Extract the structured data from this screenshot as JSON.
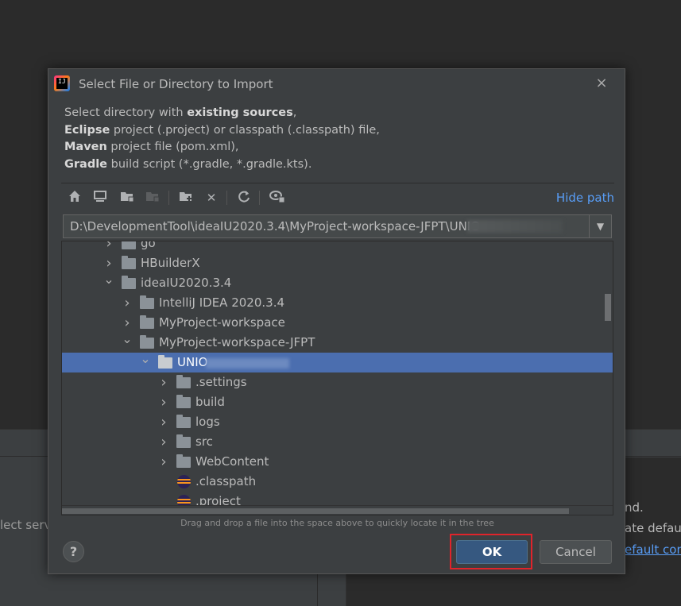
{
  "background": {
    "left_text": "lect serv",
    "right_line1": "nd.",
    "right_line2": "ate defaul",
    "right_link": "efault con"
  },
  "dialog": {
    "app_icon_text": "IJ",
    "title": "Select File or Directory to Import",
    "close_icon": "×",
    "description": {
      "line1_a": "Select directory with ",
      "line1_b": "existing sources",
      "line1_c": ",",
      "line2_a": "Eclipse",
      "line2_b": " project (.project) or classpath (.classpath) file,",
      "line3_a": "Maven",
      "line3_b": " project file (pom.xml),",
      "line4_a": "Gradle",
      "line4_b": " build script (*.gradle, *.gradle.kts)."
    },
    "toolbar": {
      "home_icon": "⌂",
      "desktop_icon": "▭",
      "project_icon": "▪",
      "module_icon": "▪",
      "new_folder_icon": "▪",
      "delete_icon": "✕",
      "refresh_icon": "↻",
      "show_hidden_icon": "◉",
      "hide_path_label": "Hide path"
    },
    "path": {
      "value": "D:\\DevelopmentTool\\ideaIU2020.3.4\\MyProject-workspace-JFPT\\UNIO",
      "dropdown_icon": "▼"
    },
    "tree": [
      {
        "label": "go",
        "type": "folder",
        "level": 2,
        "expanded": false
      },
      {
        "label": "HBuilderX",
        "type": "folder",
        "level": 2,
        "expanded": false
      },
      {
        "label": "ideaIU2020.3.4",
        "type": "folder",
        "level": 2,
        "expanded": true
      },
      {
        "label": "IntelliJ IDEA 2020.3.4",
        "type": "folder",
        "level": 3,
        "expanded": false
      },
      {
        "label": "MyProject-workspace",
        "type": "folder",
        "level": 3,
        "expanded": false
      },
      {
        "label": "MyProject-workspace-JFPT",
        "type": "folder",
        "level": 3,
        "expanded": true
      },
      {
        "label": "UNIO",
        "type": "folder",
        "level": 4,
        "expanded": true,
        "selected": true
      },
      {
        "label": ".settings",
        "type": "folder",
        "level": 5,
        "expanded": false
      },
      {
        "label": "build",
        "type": "folder",
        "level": 5,
        "expanded": false
      },
      {
        "label": "logs",
        "type": "folder",
        "level": 5,
        "expanded": false
      },
      {
        "label": "src",
        "type": "folder",
        "level": 5,
        "expanded": false
      },
      {
        "label": "WebContent",
        "type": "folder",
        "level": 5,
        "expanded": false
      },
      {
        "label": ".classpath",
        "type": "file",
        "level": 5
      },
      {
        "label": ".project",
        "type": "file",
        "level": 5
      }
    ],
    "hint": "Drag and drop a file into the space above to quickly locate it in the tree",
    "help_label": "?",
    "ok_label": "OK",
    "cancel_label": "Cancel",
    "colors": {
      "selection": "#4b6eaf",
      "link": "#589df6",
      "ok_button": "#365880",
      "highlight_box": "#e0242b"
    }
  }
}
